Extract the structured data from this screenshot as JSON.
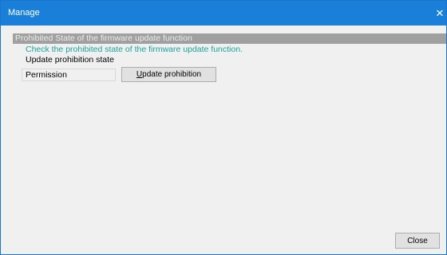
{
  "window": {
    "title": "Manage",
    "close_glyph": "✕"
  },
  "section": {
    "header": "Prohibited State of the firmware update function",
    "instruction": "Check the prohibited state of the firmware update function.",
    "state_label": "Update prohibition state",
    "state_value": "Permission"
  },
  "buttons": {
    "update_mnemonic": "U",
    "update_rest": "pdate prohibition",
    "close_label": "Close"
  },
  "icons": {
    "window_close": "close-icon"
  },
  "colors": {
    "titlebar": "#1a7fd8",
    "instruction_text": "#1aa39a",
    "section_header_bg": "#a0a0a0"
  }
}
